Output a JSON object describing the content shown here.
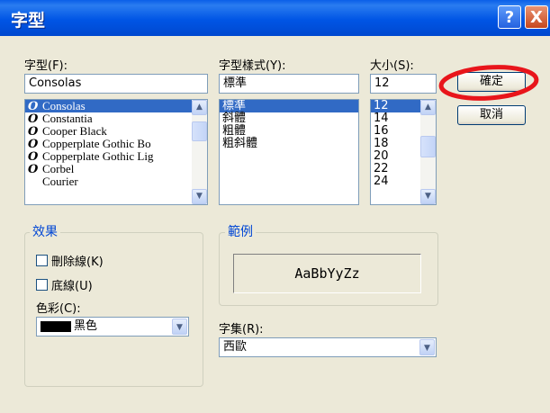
{
  "window": {
    "title": "字型",
    "help_button": "?",
    "close_button": "X"
  },
  "font": {
    "label": "字型(F):",
    "value": "Consolas",
    "items": [
      {
        "label": "Consolas",
        "selected": true
      },
      {
        "label": "Constantia",
        "selected": false
      },
      {
        "label": "Cooper Black",
        "selected": false
      },
      {
        "label": "Copperplate Gothic Bo",
        "selected": false
      },
      {
        "label": "Copperplate Gothic Lig",
        "selected": false
      },
      {
        "label": "Corbel",
        "selected": false
      },
      {
        "label": "Courier",
        "selected": false
      }
    ],
    "item_icons": [
      "opentype-font-icon",
      "opentype-font-icon",
      "opentype-font-icon",
      "opentype-font-icon",
      "opentype-font-icon",
      "opentype-font-icon",
      "raster-font-icon"
    ]
  },
  "style": {
    "label": "字型樣式(Y):",
    "value": "標準",
    "items": [
      {
        "label": "標準",
        "selected": true
      },
      {
        "label": "斜體",
        "selected": false
      },
      {
        "label": "粗體",
        "selected": false
      },
      {
        "label": "粗斜體",
        "selected": false
      }
    ]
  },
  "size": {
    "label": "大小(S):",
    "value": "12",
    "items": [
      {
        "label": "12",
        "selected": true
      },
      {
        "label": "14",
        "selected": false
      },
      {
        "label": "16",
        "selected": false
      },
      {
        "label": "18",
        "selected": false
      },
      {
        "label": "20",
        "selected": false
      },
      {
        "label": "22",
        "selected": false
      },
      {
        "label": "24",
        "selected": false
      }
    ]
  },
  "buttons": {
    "ok": "確定",
    "cancel": "取消"
  },
  "effects": {
    "title": "效果",
    "strikeout": "刪除線(K)",
    "strikeout_checked": false,
    "underline": "底線(U)",
    "underline_checked": false,
    "color_label": "色彩(C):",
    "color_value": "黑色",
    "color_swatch": "#000000"
  },
  "sample": {
    "title": "範例",
    "text": "AaBbYyZz"
  },
  "script": {
    "label": "字集(R):",
    "value": "西歐"
  },
  "annotation_color": "#e8151b"
}
